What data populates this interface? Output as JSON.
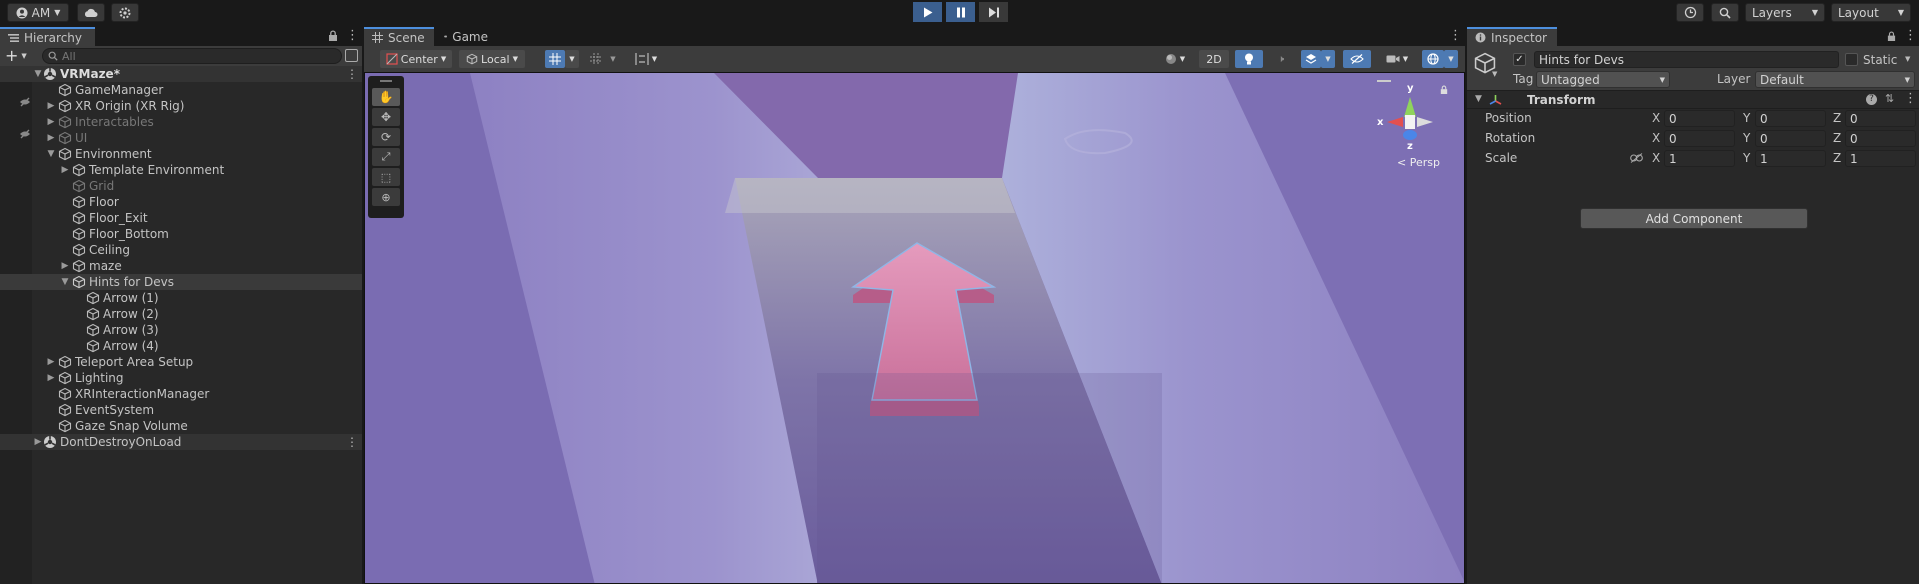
{
  "toolbar": {
    "account": "AM",
    "layers": "Layers",
    "layout": "Layout"
  },
  "hierarchy": {
    "tab": "Hierarchy",
    "search_placeholder": "All",
    "items": [
      {
        "label": "VRMaze*",
        "type": "scene"
      },
      {
        "label": "GameManager"
      },
      {
        "label": "XR Origin (XR Rig)"
      },
      {
        "label": "Interactables",
        "dim": true
      },
      {
        "label": "UI",
        "dim": true
      },
      {
        "label": "Environment"
      },
      {
        "label": "Template Environment"
      },
      {
        "label": "Grid",
        "dim": true
      },
      {
        "label": "Floor"
      },
      {
        "label": "Floor_Exit"
      },
      {
        "label": "Floor_Bottom"
      },
      {
        "label": "Ceiling"
      },
      {
        "label": "maze"
      },
      {
        "label": "Hints for Devs",
        "selected": true
      },
      {
        "label": "Arrow (1)"
      },
      {
        "label": "Arrow (2)"
      },
      {
        "label": "Arrow (3)"
      },
      {
        "label": "Arrow (4)"
      },
      {
        "label": "Teleport Area Setup"
      },
      {
        "label": "Lighting"
      },
      {
        "label": "XRInteractionManager"
      },
      {
        "label": "EventSystem"
      },
      {
        "label": "Gaze Snap Volume"
      },
      {
        "label": "DontDestroyOnLoad",
        "type": "scene"
      }
    ]
  },
  "scene": {
    "tab_scene": "Scene",
    "tab_game": "Game",
    "pivot": "Center",
    "space": "Local",
    "mode_2d": "2D",
    "gizmo_y": "y",
    "gizmo_x": "x",
    "gizmo_z": "z",
    "projection": "< Persp"
  },
  "inspector": {
    "tab": "Inspector",
    "object_name": "Hints for Devs",
    "static_label": "Static",
    "tag_label": "Tag",
    "tag_value": "Untagged",
    "layer_label": "Layer",
    "layer_value": "Default",
    "component": "Transform",
    "position_label": "Position",
    "rotation_label": "Rotation",
    "scale_label": "Scale",
    "axis_x": "X",
    "axis_y": "Y",
    "axis_z": "Z",
    "position": {
      "x": "0",
      "y": "0",
      "z": "0"
    },
    "rotation": {
      "x": "0",
      "y": "0",
      "z": "0"
    },
    "scale": {
      "x": "1",
      "y": "1",
      "z": "1"
    },
    "add_component": "Add Component"
  },
  "colors": {
    "accent": "#4d8fdd",
    "play_active": "#3b5f8f",
    "arrow_pink": "#d57aa4"
  }
}
